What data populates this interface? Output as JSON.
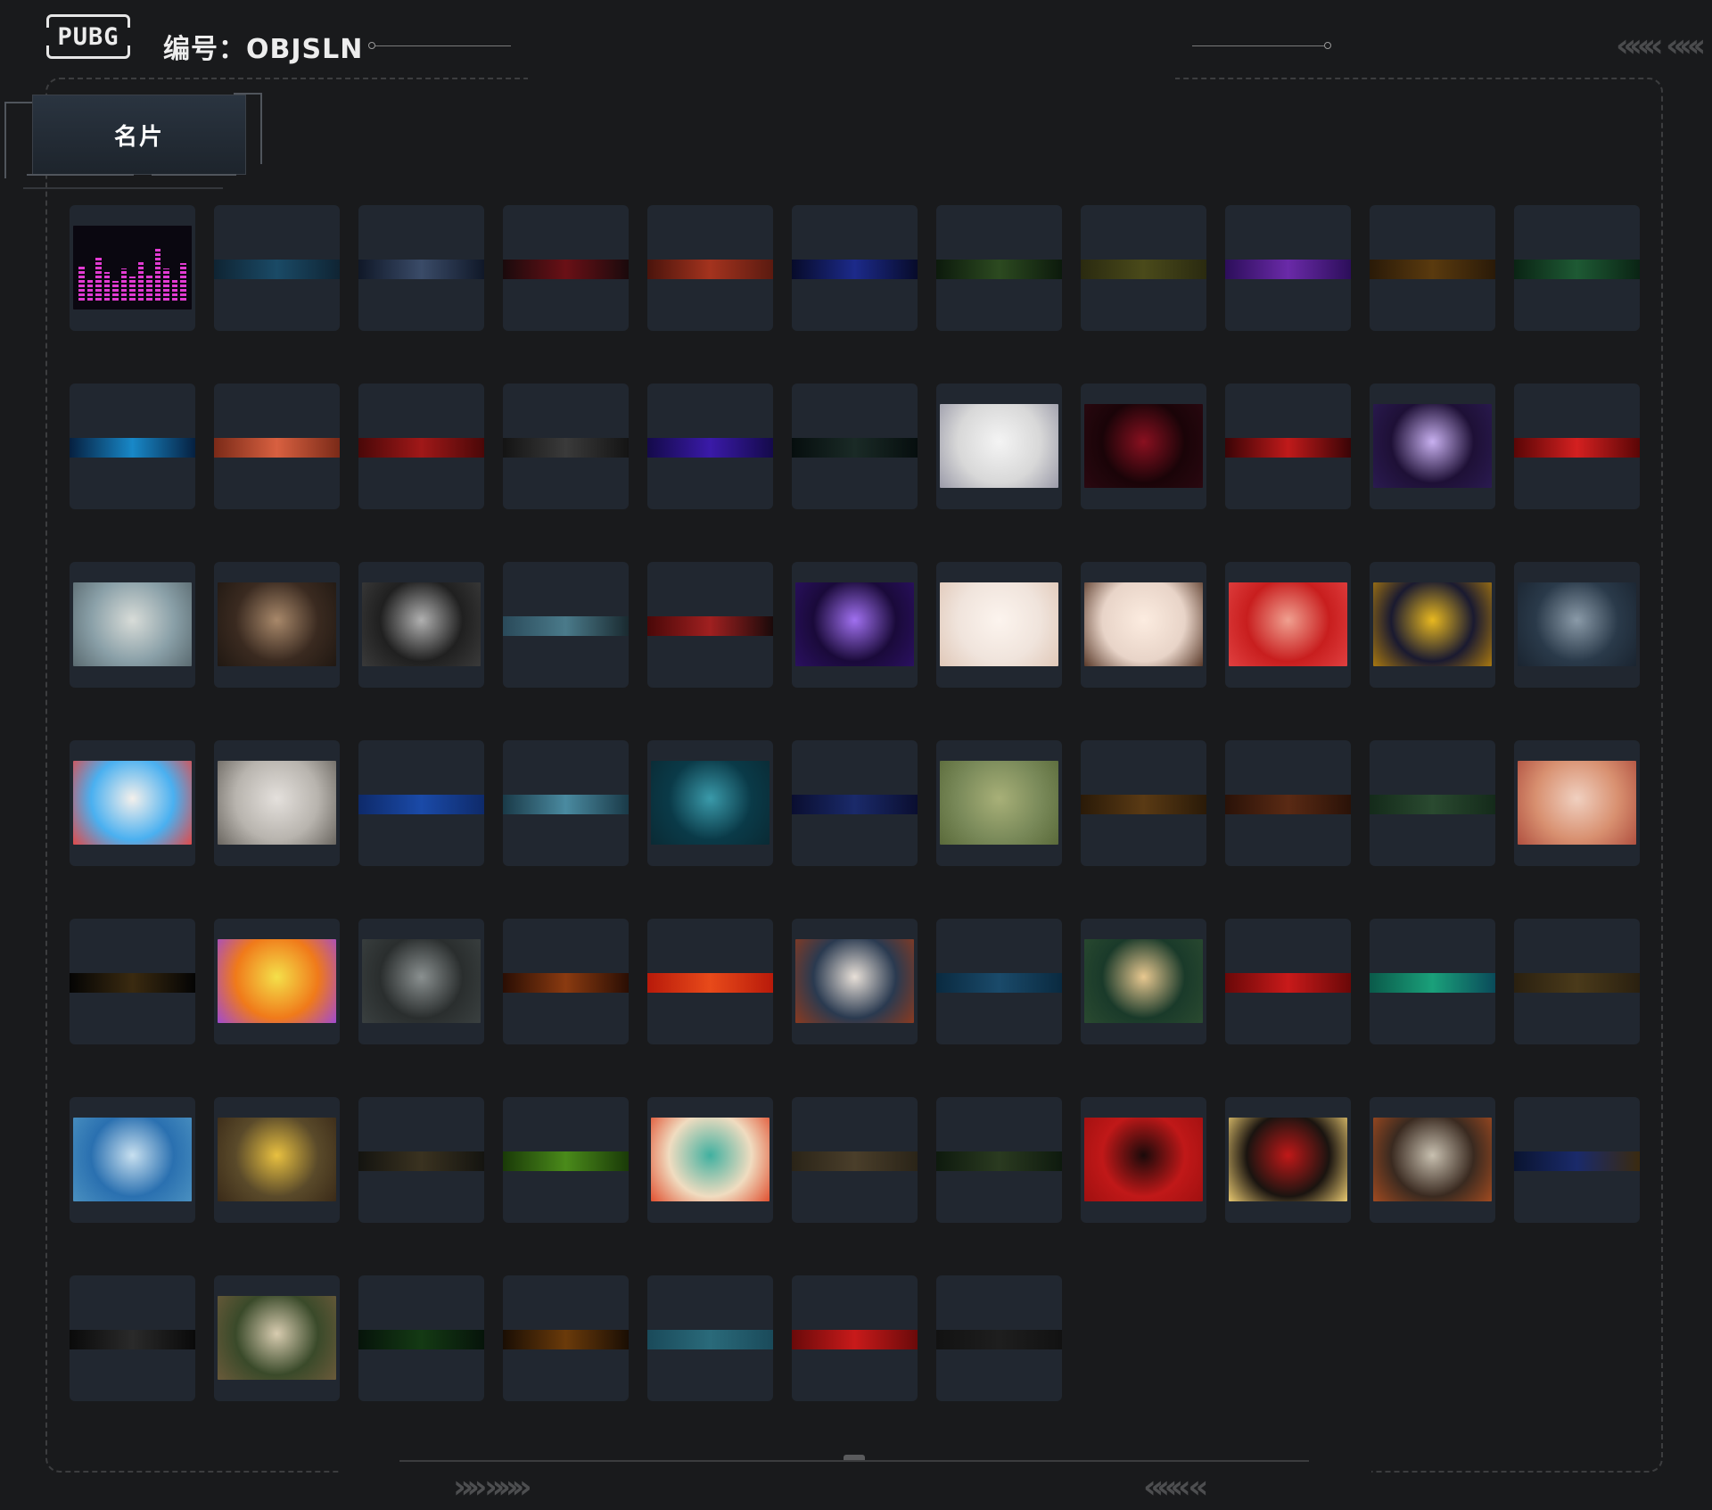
{
  "header": {
    "logo_text": "PUBG",
    "id_label": "编号：OBJSLN",
    "left_chevrons": "«««",
    "right_chevrons": "««‹"
  },
  "tab": {
    "label": "名片"
  },
  "footer": {
    "left_chevrons": "»» »»»",
    "right_chevrons": "««« «"
  },
  "cards": [
    {
      "kind": "eq"
    },
    {
      "kind": "strip",
      "colors": [
        "#0f2433",
        "#1a4a66",
        "#0f2433"
      ]
    },
    {
      "kind": "strip",
      "colors": [
        "#101828",
        "#3a4b68",
        "#101828"
      ]
    },
    {
      "kind": "strip",
      "colors": [
        "#1a0a0c",
        "#6a1016",
        "#1a0a0c"
      ]
    },
    {
      "kind": "strip",
      "colors": [
        "#4a140c",
        "#a4331e",
        "#5a1a10"
      ]
    },
    {
      "kind": "strip",
      "colors": [
        "#070b2a",
        "#1c2a8a",
        "#070b2a"
      ]
    },
    {
      "kind": "strip",
      "colors": [
        "#0c1a0c",
        "#2c4a20",
        "#0c1a0c"
      ]
    },
    {
      "kind": "strip",
      "colors": [
        "#2a2a10",
        "#4a4a1a",
        "#2a2a10"
      ]
    },
    {
      "kind": "strip",
      "colors": [
        "#2c0e5a",
        "#6a2aa8",
        "#2c0e5a"
      ]
    },
    {
      "kind": "strip",
      "colors": [
        "#2a1a08",
        "#5a3a0e",
        "#2a1a08"
      ]
    },
    {
      "kind": "strip",
      "colors": [
        "#0a2414",
        "#1e5a34",
        "#0a2414"
      ]
    },
    {
      "kind": "strip",
      "colors": [
        "#062040",
        "#1888c8",
        "#062040"
      ]
    },
    {
      "kind": "strip",
      "colors": [
        "#7a2a18",
        "#d86040",
        "#7a2a18"
      ]
    },
    {
      "kind": "strip",
      "colors": [
        "#4a0808",
        "#a01818",
        "#4a0808"
      ]
    },
    {
      "kind": "strip",
      "colors": [
        "#141414",
        "#3a3a3a",
        "#141414"
      ]
    },
    {
      "kind": "strip",
      "colors": [
        "#140a4a",
        "#3a1aa8",
        "#140a4a"
      ]
    },
    {
      "kind": "strip",
      "colors": [
        "#060e0e",
        "#1a2a26",
        "#060e0e"
      ]
    },
    {
      "kind": "img",
      "colors": [
        "#d8d8d8",
        "#f4f4f4",
        "#9a9aa8"
      ]
    },
    {
      "kind": "img",
      "colors": [
        "#1a0408",
        "#8a1020",
        "#2a0810"
      ]
    },
    {
      "kind": "strip",
      "colors": [
        "#3a0406",
        "#c01a1a",
        "#3a0406"
      ]
    },
    {
      "kind": "img",
      "colors": [
        "#1e1036",
        "#c8b0f0",
        "#2a1a50"
      ]
    },
    {
      "kind": "strip",
      "colors": [
        "#5a0606",
        "#d42020",
        "#5a0606"
      ]
    },
    {
      "kind": "img",
      "colors": [
        "#8aa0a8",
        "#d8dcd8",
        "#5a6a70"
      ]
    },
    {
      "kind": "img",
      "colors": [
        "#3a2a20",
        "#a8886a",
        "#201812"
      ]
    },
    {
      "kind": "img",
      "colors": [
        "#202020",
        "#b0b0b0",
        "#3a3a3a"
      ]
    },
    {
      "kind": "strip",
      "colors": [
        "#2a4a5a",
        "#4a7a8a",
        "#1a2a30"
      ]
    },
    {
      "kind": "strip",
      "colors": [
        "#4a0808",
        "#a02020",
        "#1a0a0a"
      ]
    },
    {
      "kind": "img",
      "colors": [
        "#1a0a3a",
        "#a070f0",
        "#2a1060"
      ]
    },
    {
      "kind": "img",
      "colors": [
        "#f0e4dc",
        "#fcf4ee",
        "#e0c8b8"
      ]
    },
    {
      "kind": "img",
      "colors": [
        "#e8d4c8",
        "#fcece0",
        "#5a3a2a"
      ]
    },
    {
      "kind": "img",
      "colors": [
        "#c81e1e",
        "#f0a090",
        "#e04040"
      ]
    },
    {
      "kind": "img",
      "colors": [
        "#1a1a30",
        "#e8b820",
        "#a87810"
      ]
    },
    {
      "kind": "img",
      "colors": [
        "#2a3a4a",
        "#8a9aa8",
        "#1a2430"
      ]
    },
    {
      "kind": "img",
      "colors": [
        "#4ab0f0",
        "#f4f0ec",
        "#e04a4a"
      ]
    },
    {
      "kind": "img",
      "colors": [
        "#b8b4ae",
        "#e4e0dc",
        "#6a6660"
      ]
    },
    {
      "kind": "strip",
      "colors": [
        "#0e2a6a",
        "#1a4aa8",
        "#0e2a6a"
      ]
    },
    {
      "kind": "strip",
      "colors": [
        "#1a3a48",
        "#4a8aa0",
        "#1a3a48"
      ]
    },
    {
      "kind": "img",
      "colors": [
        "#0a3a48",
        "#3a9aaa",
        "#0a2a34"
      ]
    },
    {
      "kind": "strip",
      "colors": [
        "#0a0e30",
        "#1a2a6a",
        "#0a0e30"
      ]
    },
    {
      "kind": "img",
      "colors": [
        "#7a8a5a",
        "#a8b078",
        "#5a6a3a"
      ]
    },
    {
      "kind": "strip",
      "colors": [
        "#2a1a08",
        "#5a3a14",
        "#2a1a08"
      ]
    },
    {
      "kind": "strip",
      "colors": [
        "#2a1208",
        "#5a2a14",
        "#2a1208"
      ]
    },
    {
      "kind": "strip",
      "colors": [
        "#142a1a",
        "#2a4a30",
        "#142a1a"
      ]
    },
    {
      "kind": "img",
      "colors": [
        "#d89070",
        "#f0d0c0",
        "#b05040"
      ]
    },
    {
      "kind": "strip",
      "colors": [
        "#040404",
        "#3a2a10",
        "#040404"
      ]
    },
    {
      "kind": "img",
      "colors": [
        "#f07a1a",
        "#f4e04a",
        "#a04ad0"
      ]
    },
    {
      "kind": "img",
      "colors": [
        "#2a2e2e",
        "#8a9090",
        "#3a4040"
      ]
    },
    {
      "kind": "strip",
      "colors": [
        "#2a0e04",
        "#8a3a10",
        "#2a0e04"
      ]
    },
    {
      "kind": "strip",
      "colors": [
        "#b81a0a",
        "#e84a1a",
        "#b81a0a"
      ]
    },
    {
      "kind": "img",
      "colors": [
        "#2a3a50",
        "#e8e0d8",
        "#8a3a20"
      ]
    },
    {
      "kind": "strip",
      "colors": [
        "#0a2a40",
        "#1a4a6a",
        "#0a2a40"
      ]
    },
    {
      "kind": "img",
      "colors": [
        "#1a3a2a",
        "#e8c890",
        "#2a4a30"
      ]
    },
    {
      "kind": "strip",
      "colors": [
        "#6a0808",
        "#c81a1a",
        "#6a0808"
      ]
    },
    {
      "kind": "strip",
      "colors": [
        "#0a5a4a",
        "#1aa07a",
        "#0a4a5a"
      ]
    },
    {
      "kind": "strip",
      "colors": [
        "#2a2010",
        "#4a3a1a",
        "#2a2010"
      ]
    },
    {
      "kind": "img",
      "colors": [
        "#2a70b0",
        "#c8e0f0",
        "#4a90c0"
      ]
    },
    {
      "kind": "img",
      "colors": [
        "#5a4a2a",
        "#e8c040",
        "#3a2a18"
      ]
    },
    {
      "kind": "strip",
      "colors": [
        "#141410",
        "#3a3220",
        "#141410"
      ]
    },
    {
      "kind": "strip",
      "colors": [
        "#1a3a08",
        "#4a8a1a",
        "#1a3a08"
      ]
    },
    {
      "kind": "img",
      "colors": [
        "#f0dcc0",
        "#40b0a0",
        "#e05030"
      ]
    },
    {
      "kind": "strip",
      "colors": [
        "#2a2418",
        "#4a3e2a",
        "#2a2418"
      ]
    },
    {
      "kind": "strip",
      "colors": [
        "#0e1a0e",
        "#2a3a20",
        "#0e1a0e"
      ]
    },
    {
      "kind": "img",
      "colors": [
        "#c01818",
        "#1a0a0a",
        "#a01010"
      ]
    },
    {
      "kind": "img",
      "colors": [
        "#1a1410",
        "#c01818",
        "#e8c870"
      ]
    },
    {
      "kind": "img",
      "colors": [
        "#3a2a20",
        "#c8c0b0",
        "#a04a20"
      ]
    },
    {
      "kind": "strip",
      "colors": [
        "#0a1430",
        "#1a2a6a",
        "#3a2a10"
      ]
    },
    {
      "kind": "strip",
      "colors": [
        "#0a0a0a",
        "#2a2a2a",
        "#0a0a0a"
      ]
    },
    {
      "kind": "img",
      "colors": [
        "#3a4a2a",
        "#d8ccb0",
        "#6a5a3a"
      ]
    },
    {
      "kind": "strip",
      "colors": [
        "#06140a",
        "#143a14",
        "#06140a"
      ]
    },
    {
      "kind": "strip",
      "colors": [
        "#1a0e04",
        "#6a3a0a",
        "#1a0e04"
      ]
    },
    {
      "kind": "strip",
      "colors": [
        "#1a4a5a",
        "#2a6a7a",
        "#1a4a5a"
      ]
    },
    {
      "kind": "strip",
      "colors": [
        "#6a0a0a",
        "#c81a1a",
        "#6a0a0a"
      ]
    },
    {
      "kind": "strip",
      "colors": [
        "#121212",
        "#1e1e1e",
        "#121212"
      ]
    }
  ]
}
